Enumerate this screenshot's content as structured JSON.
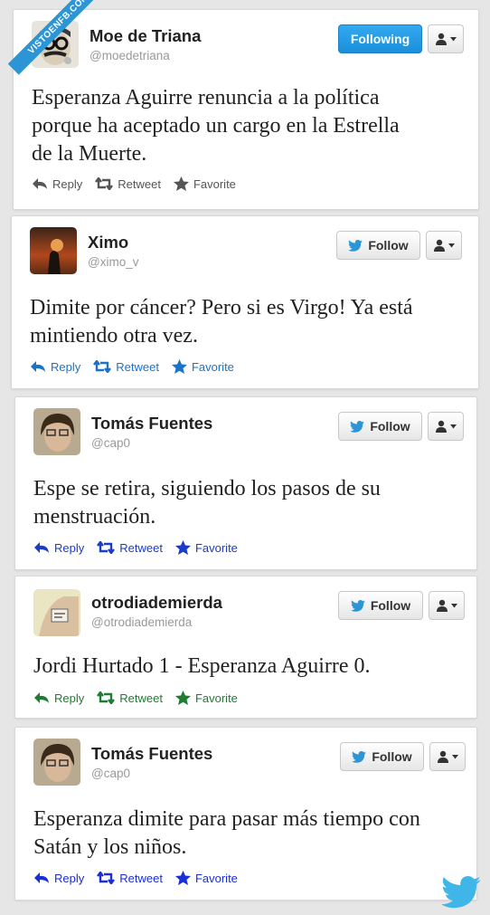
{
  "watermark": "VISTOENFB.COM",
  "tweets": [
    {
      "name": "Moe de Triana",
      "handle": "@moedetriana",
      "follow_label": "Following",
      "follow_state": "following",
      "lines": [
        "Esperanza Aguirre renuncia a la política",
        "porque ha aceptado un cargo en la Estrella",
        "de la Muerte."
      ],
      "actions": [
        "Reply",
        "Retweet",
        "Favorite"
      ],
      "action_color": "#555555"
    },
    {
      "name": "Ximo",
      "handle": "@ximo_v",
      "follow_label": "Follow",
      "follow_state": "follow",
      "lines": [
        "Dimite por cáncer? Pero si es Virgo! Ya está",
        "mintiendo otra vez."
      ],
      "actions": [
        "Reply",
        "Retweet",
        "Favorite"
      ],
      "action_color": "#1a73c8"
    },
    {
      "name": "Tomás Fuentes",
      "handle": "@cap0",
      "follow_label": "Follow",
      "follow_state": "follow",
      "lines": [
        "Espe se retira, siguiendo los pasos de su",
        "menstruación."
      ],
      "actions": [
        "Reply",
        "Retweet",
        "Favorite"
      ],
      "action_color": "#1a3cc8"
    },
    {
      "name": "otrodiademierda",
      "handle": "@otrodiademierda",
      "follow_label": "Follow",
      "follow_state": "follow",
      "lines": [
        "Jordi Hurtado 1 - Esperanza Aguirre 0."
      ],
      "actions": [
        "Reply",
        "Retweet",
        "Favorite"
      ],
      "action_color": "#1e7d32"
    },
    {
      "name": "Tomás Fuentes",
      "handle": "@cap0",
      "follow_label": "Follow",
      "follow_state": "follow",
      "lines": [
        "Esperanza dimite para pasar más tiempo con",
        "Satán y los niños."
      ],
      "actions": [
        "Reply",
        "Retweet",
        "Favorite"
      ],
      "action_color": "#1a2fd6"
    }
  ],
  "icons": {
    "follow_bird": "twitter-bird-icon",
    "more_menu": "user-menu-icon",
    "reply": "reply-arrow-icon",
    "retweet": "retweet-icon",
    "favorite": "star-icon",
    "logo": "twitter-bird-logo-icon"
  },
  "colors": {
    "following_button": "#1b8fdb",
    "twitter_blue": "#2b95d6"
  }
}
